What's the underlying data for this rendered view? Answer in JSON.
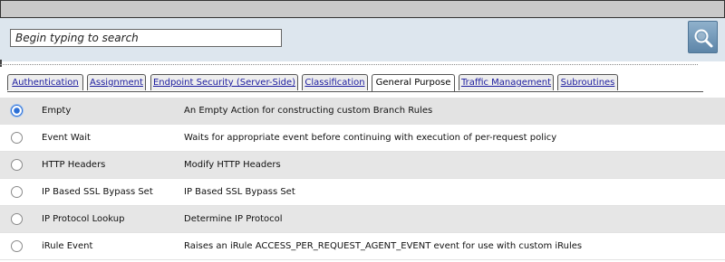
{
  "search": {
    "placeholder": "Begin typing to search",
    "value": ""
  },
  "tabs": [
    {
      "label": "Authentication",
      "active": false
    },
    {
      "label": "Assignment",
      "active": false
    },
    {
      "label": "Endpoint Security (Server-Side)",
      "active": false
    },
    {
      "label": "Classification",
      "active": false
    },
    {
      "label": "General Purpose",
      "active": true
    },
    {
      "label": "Traffic Management",
      "active": false
    },
    {
      "label": "Subroutines",
      "active": false
    }
  ],
  "rows": [
    {
      "name": "Empty",
      "description": "An Empty Action for constructing custom Branch Rules",
      "selected": true
    },
    {
      "name": "Event Wait",
      "description": "Waits for appropriate event before continuing with execution of per-request policy",
      "selected": false
    },
    {
      "name": "HTTP Headers",
      "description": "Modify HTTP Headers",
      "selected": false
    },
    {
      "name": "IP Based SSL Bypass Set",
      "description": "IP Based SSL Bypass Set",
      "selected": false
    },
    {
      "name": "IP Protocol Lookup",
      "description": "Determine IP Protocol",
      "selected": false
    },
    {
      "name": "iRule Event",
      "description": "Raises an iRule ACCESS_PER_REQUEST_AGENT_EVENT event for use with custom iRules",
      "selected": false
    }
  ],
  "colors": {
    "search_bar_bg": "#dde6ee",
    "selected_radio": "#2b6fd6",
    "tab_link": "#1a1a9e",
    "row_shade": "#e6e6e6"
  },
  "icons": {
    "search_button": "magnifier-icon"
  }
}
